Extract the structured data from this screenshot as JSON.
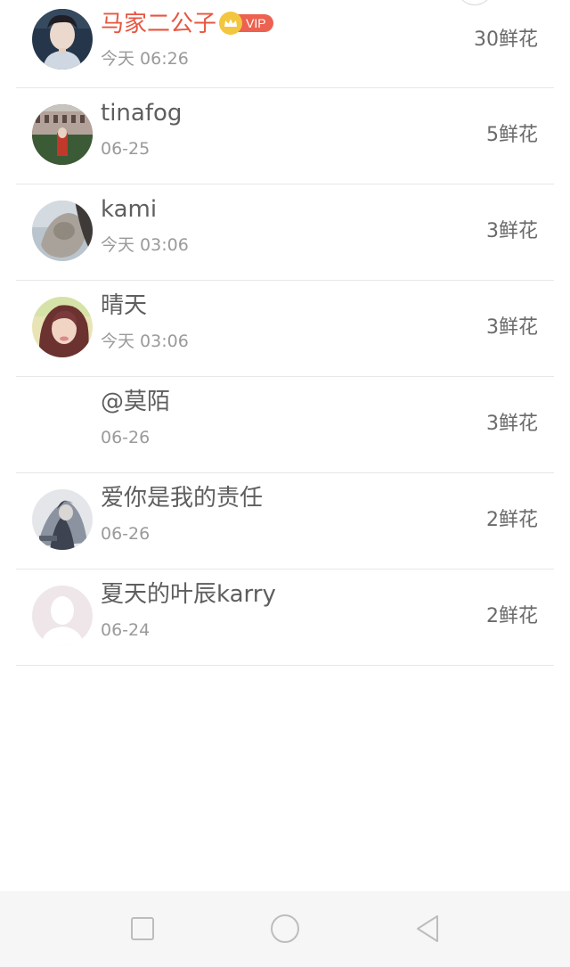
{
  "rankings": [
    {
      "name": "马家二公子",
      "time": "今天 06:26",
      "flowers": "30鲜花",
      "vip": true,
      "vip_label": "VIP",
      "avatar": "young-man-portrait"
    },
    {
      "name": "tinafog",
      "time": "06-25",
      "flowers": "5鲜花",
      "vip": false,
      "avatar": "building-scene"
    },
    {
      "name": "kami",
      "time": "今天 03:06",
      "flowers": "3鲜花",
      "vip": false,
      "avatar": "blurry-hand"
    },
    {
      "name": "晴天",
      "time": "今天 03:06",
      "flowers": "3鲜花",
      "vip": false,
      "avatar": "woman-portrait"
    },
    {
      "name": "@莫陌",
      "time": "06-26",
      "flowers": "3鲜花",
      "vip": false,
      "avatar": "none"
    },
    {
      "name": "爱你是我的责任",
      "time": "06-26",
      "flowers": "2鲜花",
      "vip": false,
      "avatar": "anime-sketch"
    },
    {
      "name": "夏天的叶辰karry",
      "time": "06-24",
      "flowers": "2鲜花",
      "vip": false,
      "avatar": "default-silhouette"
    }
  ],
  "nav": {
    "recent": "square-icon",
    "home": "circle-icon",
    "back": "triangle-back-icon"
  },
  "colors": {
    "vip_name": "#e8553f",
    "vip_badge": "#ec6150",
    "crown": "#f3c63f",
    "divider": "#e7e7e7"
  }
}
